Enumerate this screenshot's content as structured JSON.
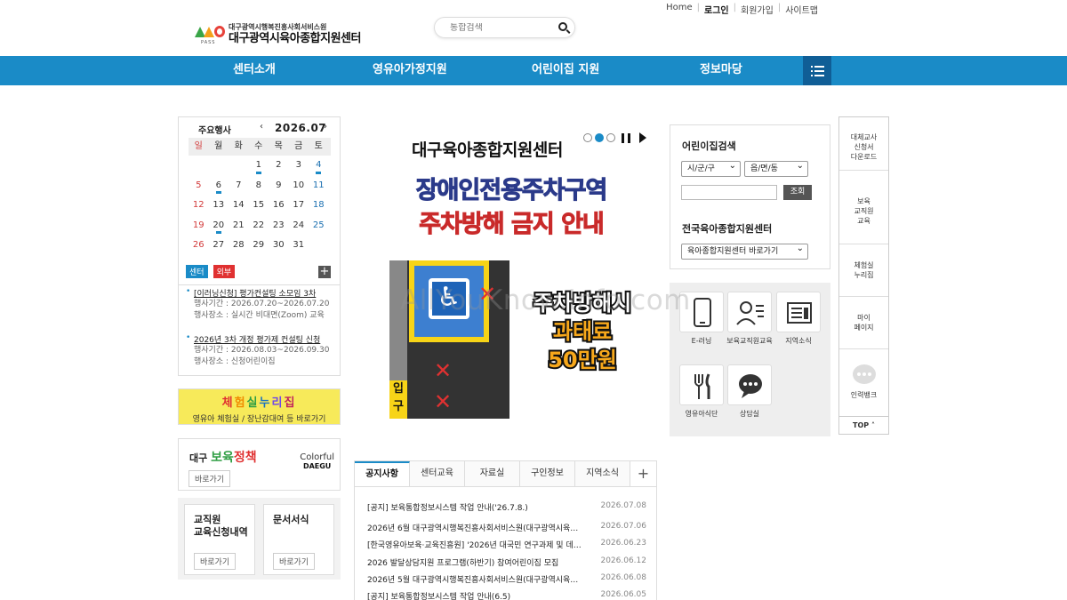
{
  "top_links": [
    "Home",
    "로그인",
    "회원가입",
    "사이트맵"
  ],
  "logo": {
    "line1": "대구광역시행복진흥사회서비스원",
    "line2": "대구광역시육아종합지원센터",
    "mark_text": "PASS"
  },
  "search": {
    "placeholder": "통합검색"
  },
  "nav": {
    "items": [
      "센터소개",
      "영유아가정지원",
      "어린이집 지원",
      "정보마당"
    ]
  },
  "calendar": {
    "title": "주요행사",
    "month": "2026.07",
    "prev": "‹",
    "next": "›",
    "dow": [
      "일",
      "월",
      "화",
      "수",
      "목",
      "금",
      "토"
    ],
    "weeks": [
      [
        "",
        "",
        "",
        "1",
        "2",
        "3",
        "4"
      ],
      [
        "5",
        "6",
        "7",
        "8",
        "9",
        "10",
        "11"
      ],
      [
        "12",
        "13",
        "14",
        "15",
        "16",
        "17",
        "18"
      ],
      [
        "19",
        "20",
        "21",
        "22",
        "23",
        "24",
        "25"
      ],
      [
        "26",
        "27",
        "28",
        "29",
        "30",
        "31",
        ""
      ]
    ],
    "event_days": [
      "1",
      "4",
      "6",
      "20"
    ],
    "tags": [
      "센터",
      "외부"
    ],
    "plus": "+",
    "events": [
      {
        "title": "[이러닝신청] 평가컨설팅 소모임 3차",
        "period": "행사기간 : 2026.07.20~2026.07.20",
        "place": "행사장소 : 실시간 비대면(Zoom) 교육"
      },
      {
        "title": "2026년 3차 개정 평가제 컨설팅 신청",
        "period": "행사기간 : 2026.08.03~2026.09.30",
        "place": "행사장소 : 신청어린이집"
      }
    ]
  },
  "banner_experience": {
    "title": "체험실누리집",
    "sub": "영유아 체험실 / 장난감대여 등 바로가기"
  },
  "banner_policy": {
    "prefix": "대구",
    "word1": "보육",
    "word2": "정책",
    "button": "바로가기",
    "logo1": "Colorful",
    "logo2": "DAEGU"
  },
  "box_training": {
    "title_lines": [
      "교직원",
      "교육신청내역"
    ],
    "button": "바로가기"
  },
  "box_forms": {
    "title_lines": [
      "문서서식"
    ],
    "button": "바로가기"
  },
  "main_banner": {
    "title": "대구육아종합지원센터",
    "line1": "장애인전용주차구역",
    "line2": "주차방해 금지 안내",
    "entry": [
      "입",
      "구"
    ],
    "fine1": "주차방해시",
    "fine2": "과태료",
    "fine3": "50만원",
    "xmark": "✕",
    "accessibility_symbol": "♿"
  },
  "board": {
    "tabs": [
      "공지사항",
      "센터교육",
      "자료실",
      "구인정보",
      "지역소식"
    ],
    "plus": "+",
    "rows": [
      {
        "title": "[공지] 보육통합정보시스템 작업 안내('26.7.8.)",
        "date": "2026.07.08"
      },
      {
        "title": "2026년 6월 대구광역시행복진흥사회서비스원(대구광역시육…",
        "date": "2026.07.06"
      },
      {
        "title": "[한국영유아보육·교육진흥원] '2026년 대국민 연구과제 및 데…",
        "date": "2026.06.23"
      },
      {
        "title": "2026 발달상담지원 프로그램(하반기) 참여어린이집 모집",
        "date": "2026.06.12"
      },
      {
        "title": "2026년 5월 대구광역시행복진흥사회서비스원(대구광역시육…",
        "date": "2026.06.08"
      },
      {
        "title": "[공지] 보육통합정보시스템 작업 안내(6.5)",
        "date": "2026.06.05"
      }
    ]
  },
  "daycare_search": {
    "title": "어린이집검색",
    "select1": "시/군/구",
    "select2": "읍/면/동",
    "button": "조회",
    "center_title": "전국육아종합지원센터",
    "center_select": "육아종합지원센터 바로가기"
  },
  "quick": [
    {
      "label": "E-러닝",
      "icon": "smartphone-icon"
    },
    {
      "label": "보육교직원교육",
      "icon": "teacher-icon"
    },
    {
      "label": "지역소식",
      "icon": "news-icon"
    },
    {
      "label": "영유아식단",
      "icon": "utensils-icon"
    },
    {
      "label": "상담실",
      "icon": "chat-icon"
    }
  ],
  "sidebar": {
    "items": [
      "대체교사\n신청서\n다운로드",
      "보육\n교직원\n교육",
      "체험실\n누리집",
      "마이\n페이지",
      "인력뱅크"
    ],
    "top": "TOP ˄"
  },
  "watermark": "AllYouKnow.Info.com",
  "colors": {
    "nav": "#1a8bc7",
    "nav_menu": "#105e96",
    "accent": "#1a8bc7",
    "sunday": "#d23a3a",
    "saturday": "#1a6fb0"
  }
}
